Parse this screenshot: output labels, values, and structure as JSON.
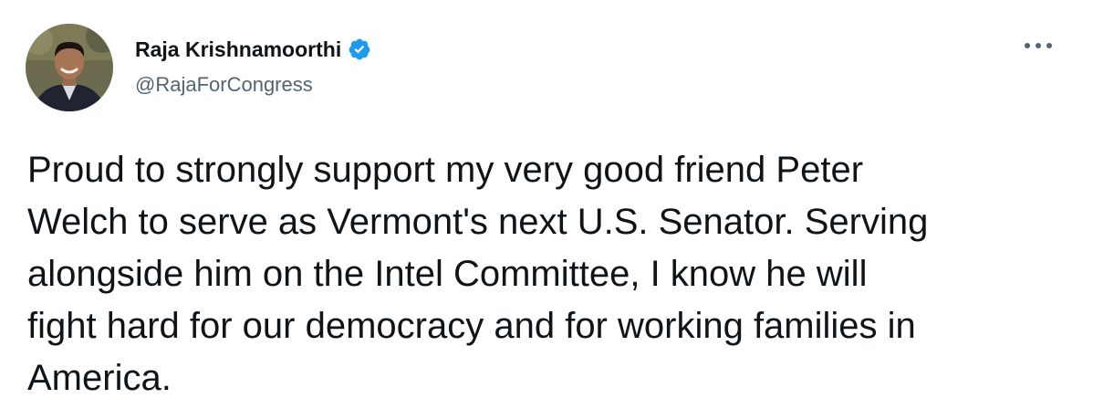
{
  "author": {
    "display_name": "Raja Krishnamoorthi",
    "handle": "@RajaForCongress",
    "verified": true
  },
  "tweet": {
    "text": "Proud to strongly support my very good friend Peter\nWelch to serve as Vermont's next U.S. Senator. Serving\nalongside him on the Intel Committee, I know he will\nfight hard for our democracy and for working families in\nAmerica."
  },
  "icons": {
    "verified": "verified-badge-icon",
    "more": "more-options-icon"
  },
  "colors": {
    "verified_blue": "#1d9bf0",
    "text": "#0f1419",
    "secondary_text": "#536471"
  }
}
